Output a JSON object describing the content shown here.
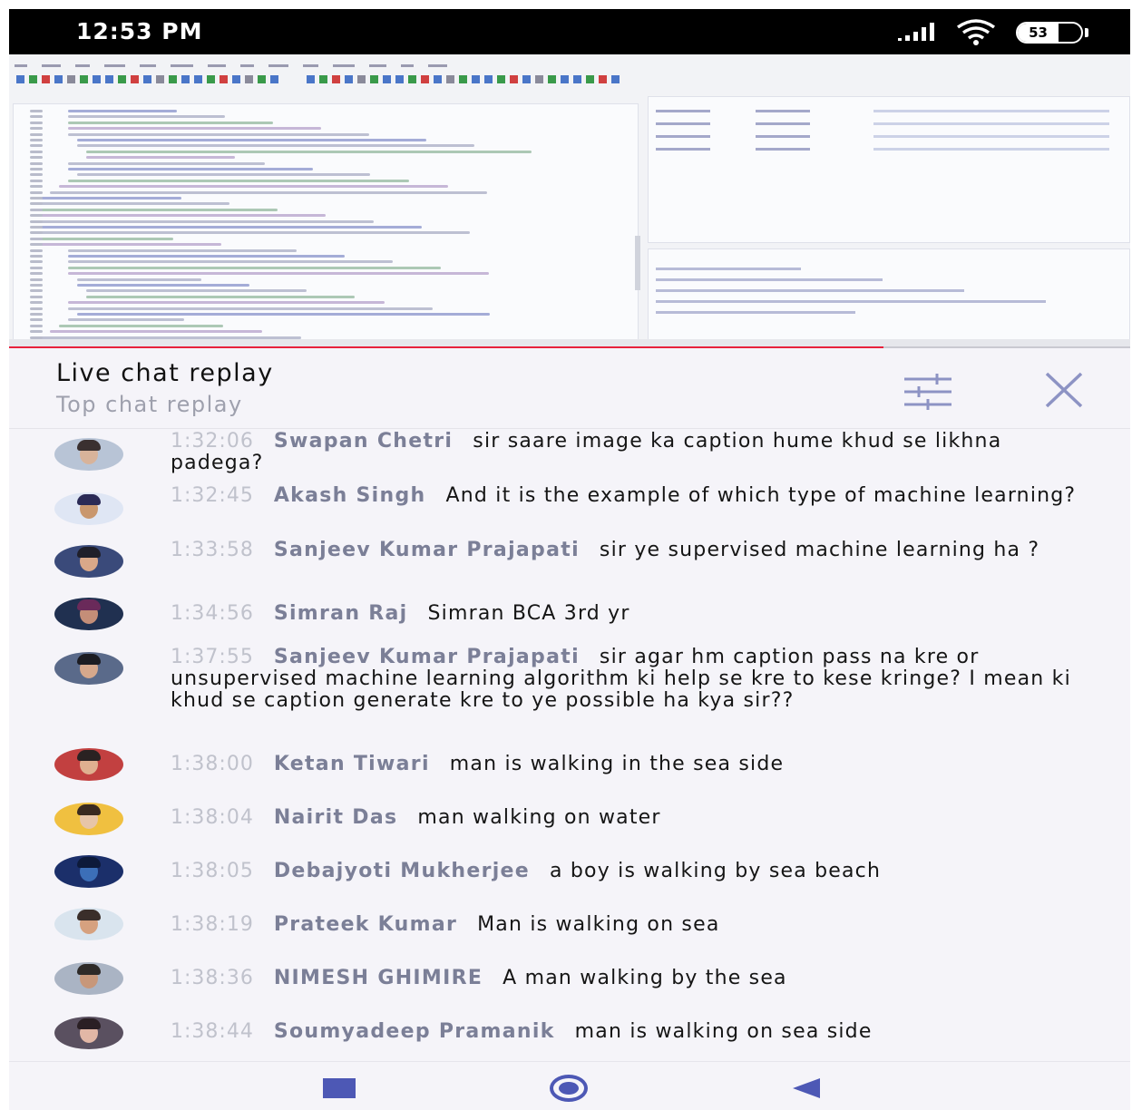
{
  "status_bar": {
    "time": "12:53 PM",
    "battery_level": "53",
    "icons": [
      "signal-icon",
      "wifi-icon",
      "battery-icon"
    ]
  },
  "video": {
    "progress_fraction": 0.78,
    "accent_color": "#e8213c"
  },
  "chat": {
    "title": "Live chat replay",
    "subtitle": "Top chat replay",
    "filter_icon": "filter-sliders-icon",
    "close_icon": "close-icon",
    "messages": [
      {
        "time": "1:32:06",
        "author": "Swapan Chetri",
        "text": "sir saare image ka caption hume khud se likhna padega?"
      },
      {
        "time": "1:32:45",
        "author": "Akash Singh",
        "text": "And it is the example of which type of machine learning?"
      },
      {
        "time": "1:33:58",
        "author": "Sanjeev Kumar Prajapati",
        "text": "sir ye supervised machine learning ha ?"
      },
      {
        "time": "1:34:56",
        "author": "Simran Raj",
        "text": "Simran BCA 3rd yr"
      },
      {
        "time": "1:37:55",
        "author": "Sanjeev Kumar Prajapati",
        "text": "sir agar hm caption pass na kre or unsupervised machine learning algorithm ki help se kre to kese kringe? I mean ki khud se caption generate kre to ye possible ha kya sir??"
      },
      {
        "time": "1:38:00",
        "author": "Ketan Tiwari",
        "text": "man is walking in the sea side"
      },
      {
        "time": "1:38:04",
        "author": "Nairit Das",
        "text": "man walking on water"
      },
      {
        "time": "1:38:05",
        "author": "Debajyoti Mukherjee",
        "text": "a boy is walking by sea beach"
      },
      {
        "time": "1:38:19",
        "author": "Prateek Kumar",
        "text": "Man is walking on sea"
      },
      {
        "time": "1:38:36",
        "author": "NIMESH GHIMIRE",
        "text": "A man walking by the sea"
      },
      {
        "time": "1:38:44",
        "author": "Soumyadeep Pramanik",
        "text": "man is walking on sea side"
      }
    ]
  },
  "nav_bar": {
    "icons": [
      "recents-icon",
      "home-icon",
      "back-icon"
    ],
    "color": "#4d58b5"
  }
}
